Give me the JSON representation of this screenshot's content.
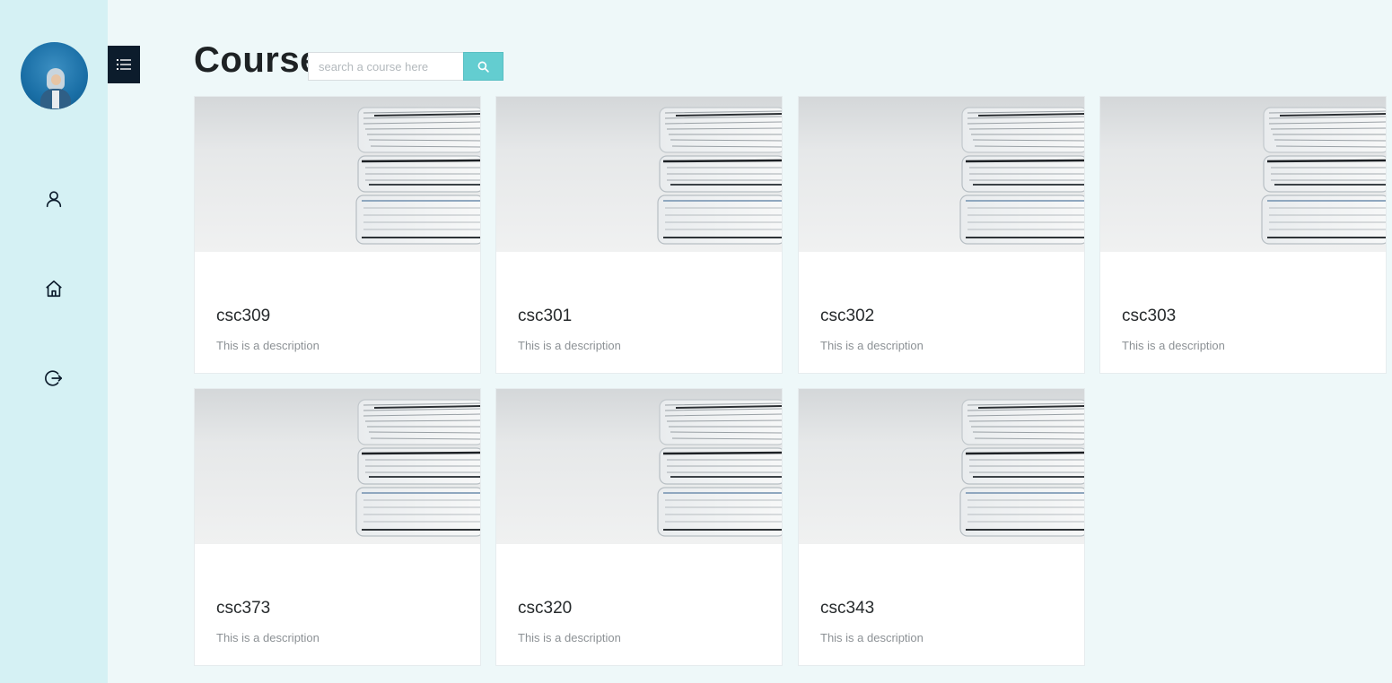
{
  "page": {
    "title": "Course"
  },
  "search": {
    "placeholder": "search a course here",
    "value": ""
  },
  "sidebar": {
    "items": [
      {
        "name": "profile",
        "icon": "user-icon"
      },
      {
        "name": "home",
        "icon": "home-icon"
      },
      {
        "name": "logout",
        "icon": "logout-icon"
      }
    ]
  },
  "menu_toggle": {
    "icon": "list-icon"
  },
  "colors": {
    "sidebar_bg": "#d5f1f4",
    "page_bg": "#eef8f9",
    "accent": "#63cdd0",
    "dark": "#0c1c2c"
  },
  "courses": [
    {
      "title": "csc309",
      "description": "This is a description"
    },
    {
      "title": "csc301",
      "description": "This is a description"
    },
    {
      "title": "csc302",
      "description": "This is a description"
    },
    {
      "title": "csc303",
      "description": "This is a description"
    },
    {
      "title": "csc373",
      "description": "This is a description"
    },
    {
      "title": "csc320",
      "description": "This is a description"
    },
    {
      "title": "csc343",
      "description": "This is a description"
    }
  ]
}
